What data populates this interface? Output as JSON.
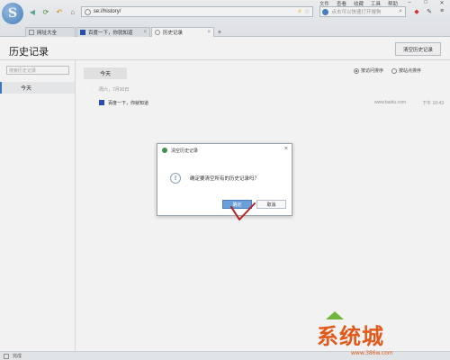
{
  "browser": {
    "menu": [
      "文件",
      "查看",
      "收藏",
      "工具",
      "帮助"
    ],
    "address": "se://history/",
    "search_placeholder": "点击可以快速打开搜狗",
    "tabs": [
      {
        "label": "网址大全",
        "active": false
      },
      {
        "label": "百度一下，你就知道",
        "active": false
      },
      {
        "label": "历史记录",
        "active": true
      }
    ],
    "new_tab": "+"
  },
  "page": {
    "title": "历史记录",
    "clear_button": "清空历史记录"
  },
  "sidebar": {
    "search_placeholder": "搜索历史记录",
    "today": "今天"
  },
  "main": {
    "today_pill": "今天",
    "sort_time": "按访问排序",
    "sort_site": "按站点排序",
    "sort_selected": "time",
    "date_label": "周六，7月30日",
    "entries": [
      {
        "title": "百度一下，你就知道",
        "url": "www.baidu.com",
        "time": "下午 10:43"
      }
    ]
  },
  "dialog": {
    "title": "清空历史记录",
    "message": "确定要清空所有的历史记录吗？",
    "ok": "确定",
    "cancel": "取消"
  },
  "status": {
    "text": "完成"
  },
  "watermark": {
    "main": "系统城",
    "sub": "www.386w.com"
  },
  "colors": {
    "accent": "#3d7fc8",
    "ok_button": "#6a9fd8",
    "watermark": "#e15a1b",
    "check": "#b22222"
  }
}
